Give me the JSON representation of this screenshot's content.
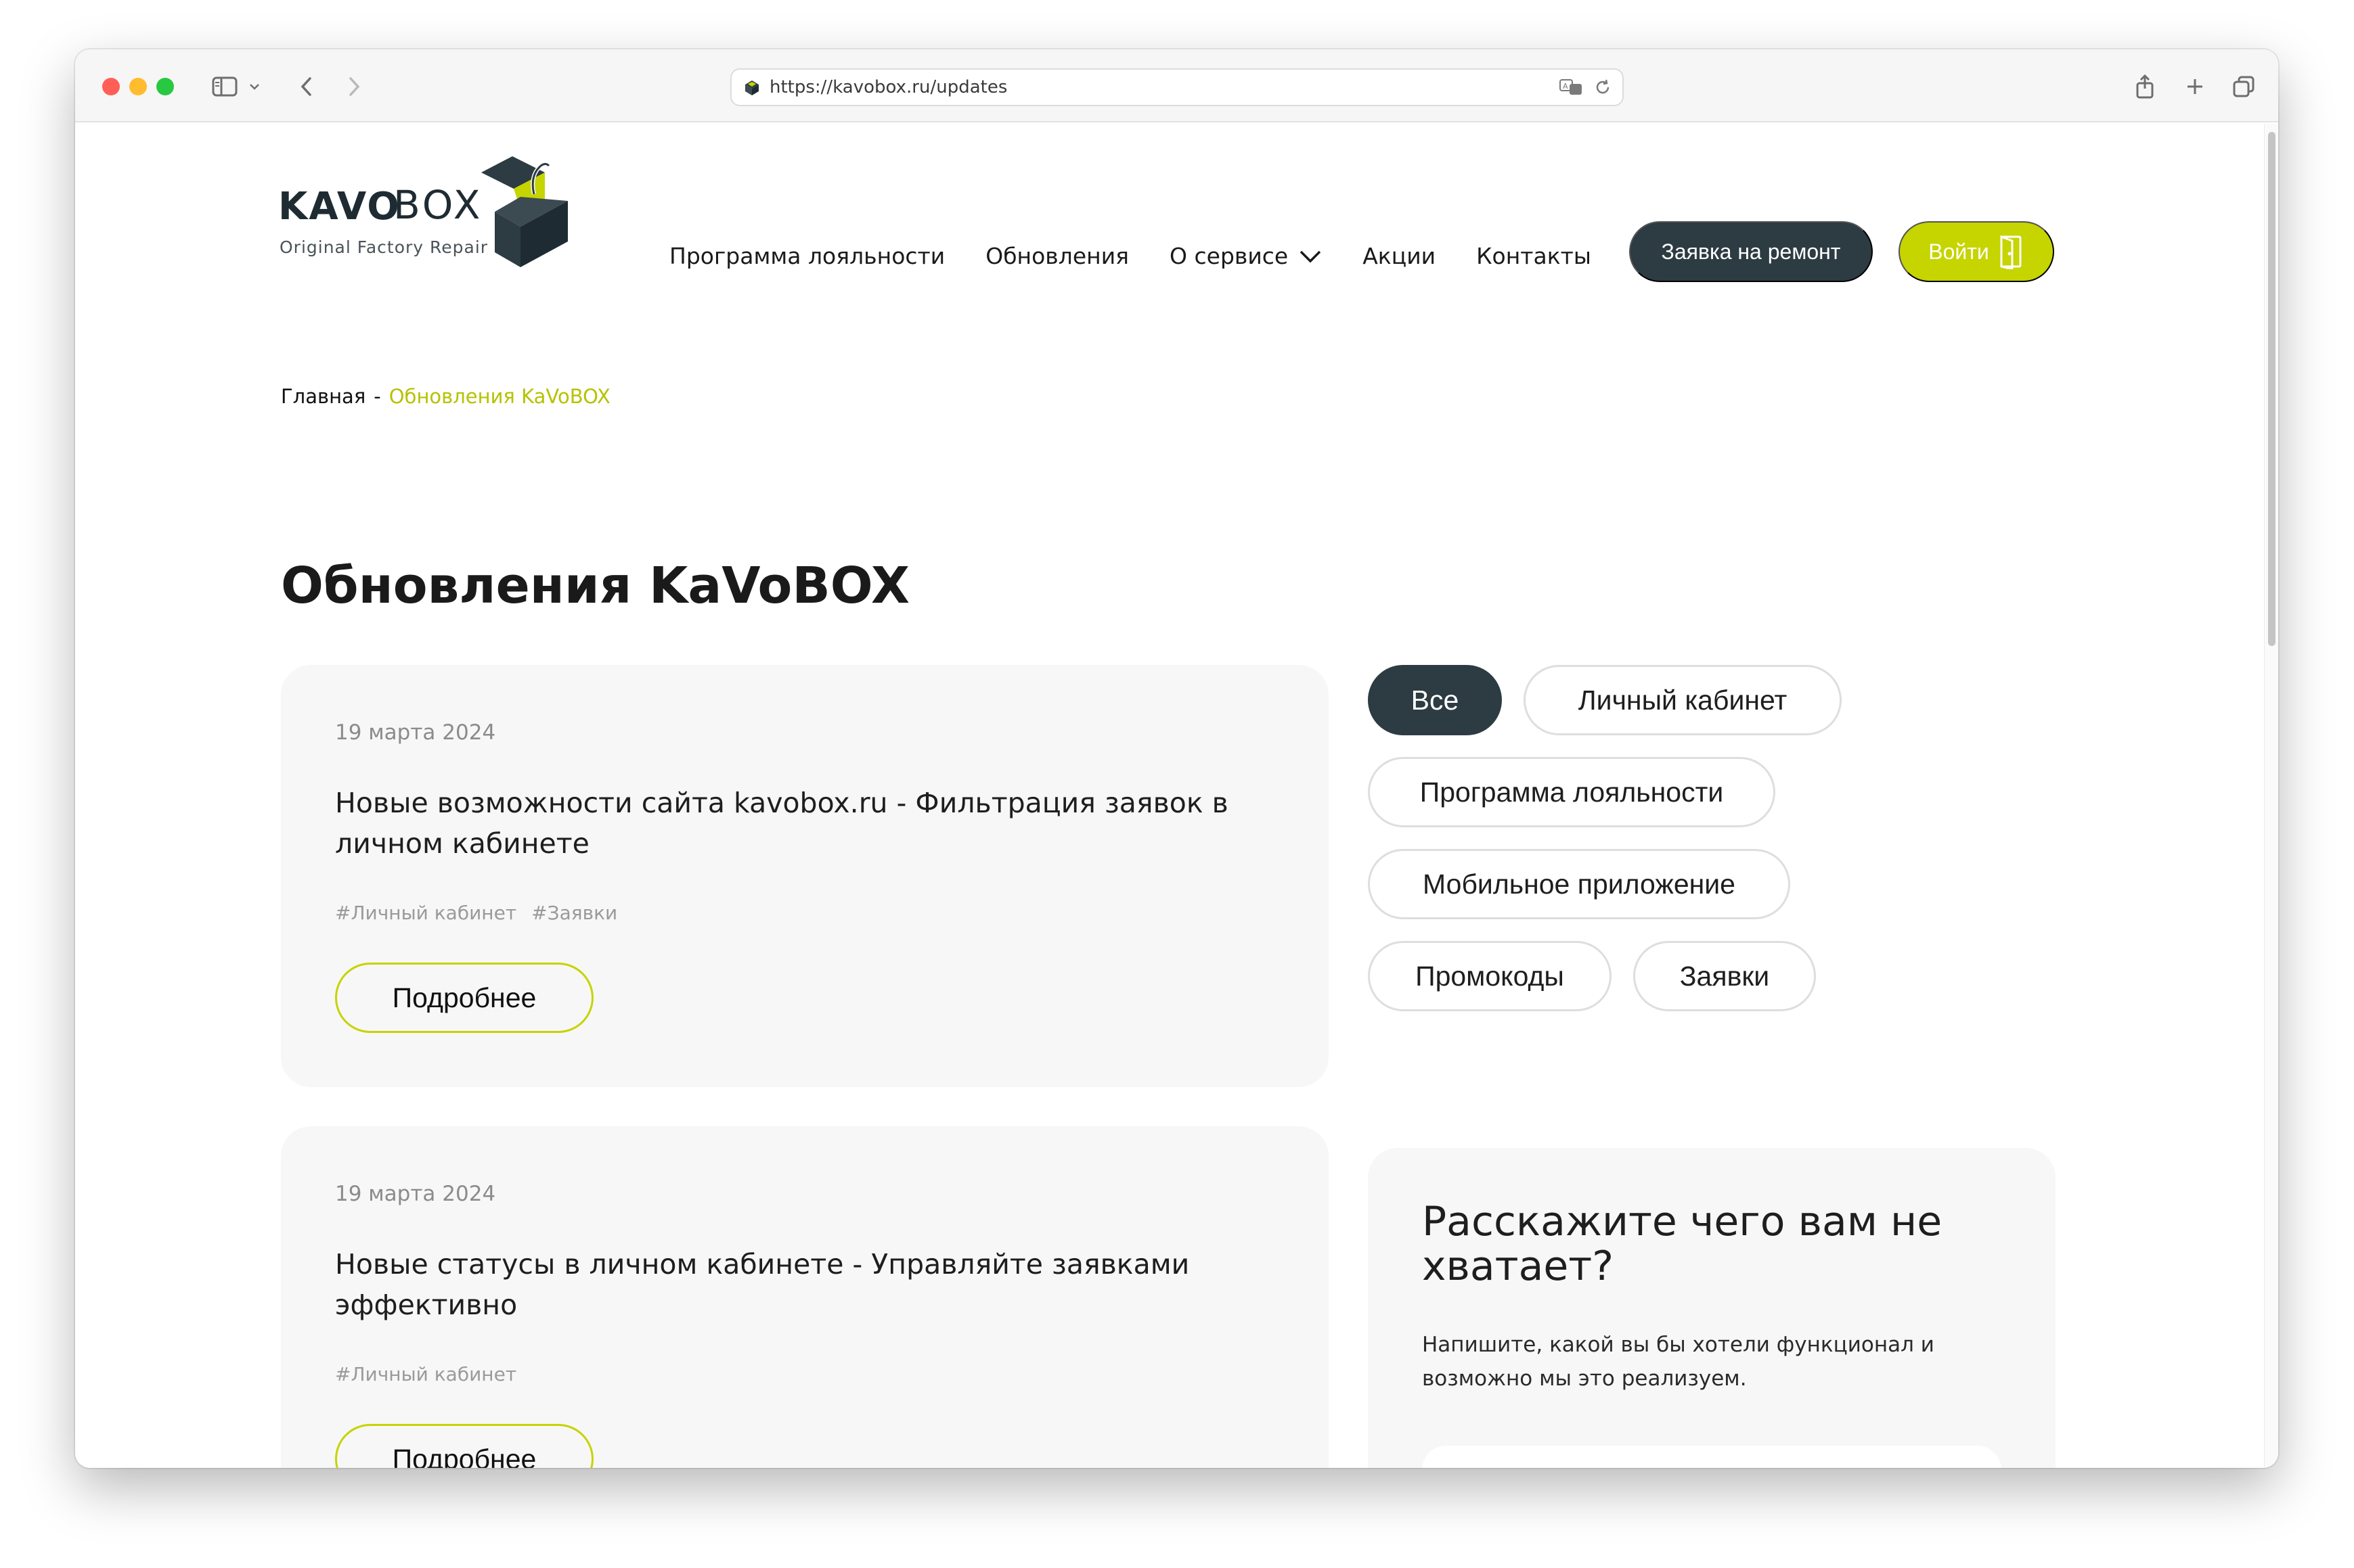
{
  "browser": {
    "url": "https://kavobox.ru/updates"
  },
  "logo": {
    "brand_left": "KAVO",
    "brand_right": "BOX",
    "tagline": "Original Factory Repair"
  },
  "nav": {
    "items": [
      {
        "label": "Программа лояльности"
      },
      {
        "label": "Обновления"
      },
      {
        "label": "О сервисе"
      },
      {
        "label": "Акции"
      },
      {
        "label": "Контакты"
      }
    ]
  },
  "header": {
    "repair_button": "Заявка на ремонт",
    "login_button": "Войти"
  },
  "breadcrumb": {
    "home": "Главная",
    "separator": "-",
    "current": "Обновления KaVoBOX"
  },
  "page": {
    "title": "Обновления KaVoBOX"
  },
  "posts": [
    {
      "date": "19 марта 2024",
      "title": "Новые возможности сайта kavobox.ru - Фильтрация заявок в личном кабинете",
      "tags": [
        "#Личный кабинет",
        "#Заявки"
      ],
      "button": "Подробнее"
    },
    {
      "date": "19 марта 2024",
      "title": "Новые статусы в личном кабинете - Управляйте заявками эффективно",
      "tags": [
        "#Личный кабинет"
      ],
      "button": "Подробнее"
    }
  ],
  "filters": [
    {
      "label": "Все",
      "active": true
    },
    {
      "label": "Личный кабинет",
      "active": false
    },
    {
      "label": "Программа лояльности",
      "active": false
    },
    {
      "label": "Мобильное приложение",
      "active": false
    },
    {
      "label": "Промокоды",
      "active": false
    },
    {
      "label": "Заявки",
      "active": false
    }
  ],
  "feedback": {
    "title": "Расскажите чего вам не хватает?",
    "text": "Напишите, какой вы бы хотели функционал и возможно мы это реализуем."
  },
  "colors": {
    "accent": "#c6d400",
    "dark": "#2d3b43",
    "card_bg": "#f7f7f7"
  }
}
